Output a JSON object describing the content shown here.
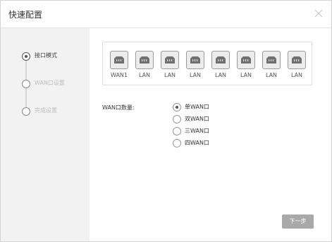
{
  "dialog": {
    "title": "快速配置"
  },
  "steps": [
    {
      "label": "接口模式"
    },
    {
      "label": "WAN口设置"
    },
    {
      "label": "完成设置"
    }
  ],
  "ports": [
    {
      "label": "WAN1"
    },
    {
      "label": "LAN"
    },
    {
      "label": "LAN"
    },
    {
      "label": "LAN"
    },
    {
      "label": "LAN"
    },
    {
      "label": "LAN"
    },
    {
      "label": "LAN"
    },
    {
      "label": "LAN"
    }
  ],
  "wan_count": {
    "label": "WAN口数量:",
    "options": [
      {
        "label": "单WAN口",
        "selected": true
      },
      {
        "label": "双WAN口",
        "selected": false
      },
      {
        "label": "三WAN口",
        "selected": false
      },
      {
        "label": "四WAN口",
        "selected": false
      }
    ]
  },
  "footer": {
    "next_label": "下一步"
  },
  "colors": {
    "sidebar_bg": "#f2f2f2",
    "button_bg": "#a9a9a9",
    "border": "#d4d4d4"
  }
}
